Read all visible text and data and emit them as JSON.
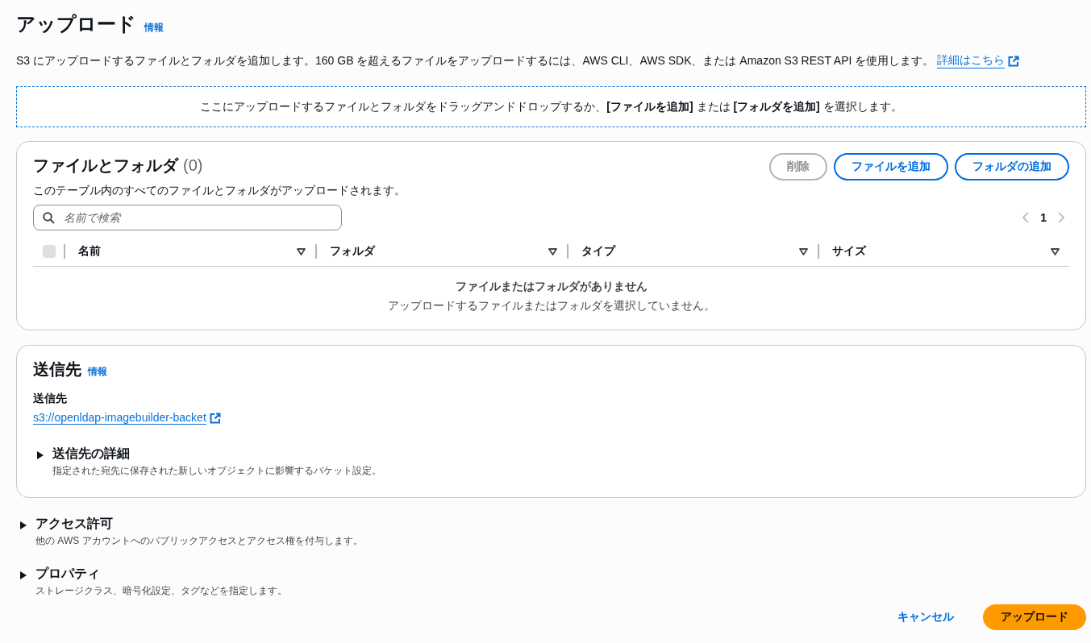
{
  "header": {
    "title": "アップロード",
    "info_link": "情報",
    "description": "S3 にアップロードするファイルとフォルダを追加します。160 GB を超えるファイルをアップロードするには、AWS CLI、AWS SDK、または Amazon S3 REST API を使用します。",
    "learn_more": "詳細はこちら"
  },
  "dropzone": {
    "text": "ここにアップロードするファイルとフォルダをドラッグアンドドロップするか、**[ファイルを追加]** または **[フォルダを追加]** を選択します。"
  },
  "files_panel": {
    "title": "ファイルとフォルダ",
    "count": "(0)",
    "description": "このテーブル内のすべてのファイルとフォルダがアップロードされます。",
    "buttons": [
      {
        "label": "削除",
        "disabled": true
      },
      {
        "label": "ファイルを追加",
        "disabled": false
      },
      {
        "label": "フォルダの追加",
        "disabled": false
      }
    ],
    "search": {
      "placeholder": "名前で検索"
    },
    "pagination": {
      "current_page": "1"
    },
    "select_all": {
      "checked": false
    },
    "columns": [
      "名前",
      "フォルダ",
      "タイプ",
      "サイズ"
    ],
    "empty": {
      "title": "ファイルまたはフォルダがありません",
      "message": "アップロードするファイルまたはフォルダを選択していません。"
    }
  },
  "destination": {
    "title": "送信先",
    "info_link": "情報",
    "field_label": "送信先",
    "url": "s3://openldap-imagebuilder-backet",
    "details": {
      "title": "送信先の詳細",
      "description": "指定された宛先に保存された新しいオブジェクトに影響するバケット設定。",
      "expanded": false
    }
  },
  "sections": [
    {
      "title": "アクセス許可",
      "description": "他の AWS アカウントへのパブリックアクセスとアクセス権を付与します。",
      "expanded": false
    },
    {
      "title": "プロパティ",
      "description": "ストレージクラス、暗号化設定、タグなどを指定します。",
      "expanded": false
    }
  ],
  "footer": {
    "buttons": [
      {
        "label": "キャンセル",
        "kind": "link"
      },
      {
        "label": "アップロード",
        "kind": "primary"
      }
    ]
  }
}
